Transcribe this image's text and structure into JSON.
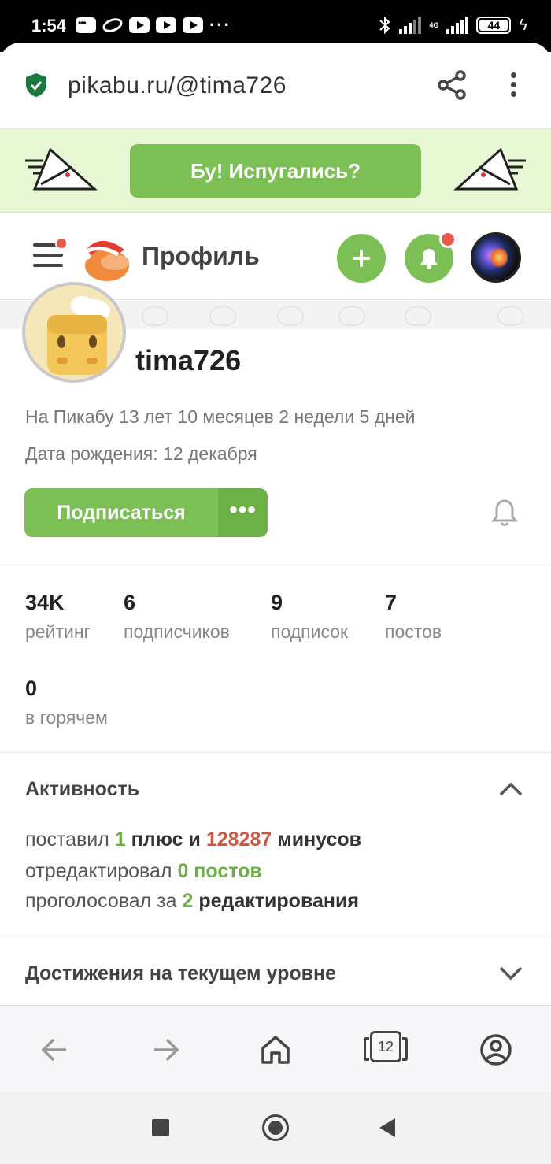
{
  "status_bar": {
    "time": "1:54",
    "network": "4G",
    "battery": "44"
  },
  "url_bar": {
    "url": "pikabu.ru/@tima726"
  },
  "banner": {
    "button_label": "Бу! Испугались?"
  },
  "header": {
    "title": "Профиль"
  },
  "profile": {
    "username": "tima726",
    "on_site": "На Пикабу 13 лет 10 месяцев 2 недели 5 дней",
    "birthday": "Дата рождения: 12 декабря",
    "subscribe_label": "Подписаться",
    "more_label": "•••"
  },
  "stats": [
    {
      "value": "34K",
      "label": "рейтинг"
    },
    {
      "value": "6",
      "label": "подписчиков"
    },
    {
      "value": "9",
      "label": "подписок"
    },
    {
      "value": "7",
      "label": "постов"
    },
    {
      "value": "0",
      "label": "в горячем"
    }
  ],
  "activity": {
    "title": "Активность",
    "line1": {
      "prefix": "поставил ",
      "plus_count": "1",
      "mid": " плюс и ",
      "minus_count": "128287",
      "suffix": " минусов"
    },
    "line2": {
      "prefix": "отредактировал ",
      "value": "0 постов"
    },
    "line3": {
      "prefix": "проголосовал за ",
      "value": "2",
      "suffix": " редактирования"
    }
  },
  "achievements": {
    "title": "Достижения на текущем уровне"
  },
  "browser_bar": {
    "tabs_count": "12"
  },
  "colors": {
    "accent_green": "#7cc055",
    "minus_red": "#d0553f",
    "notification_red": "#e8584b"
  }
}
